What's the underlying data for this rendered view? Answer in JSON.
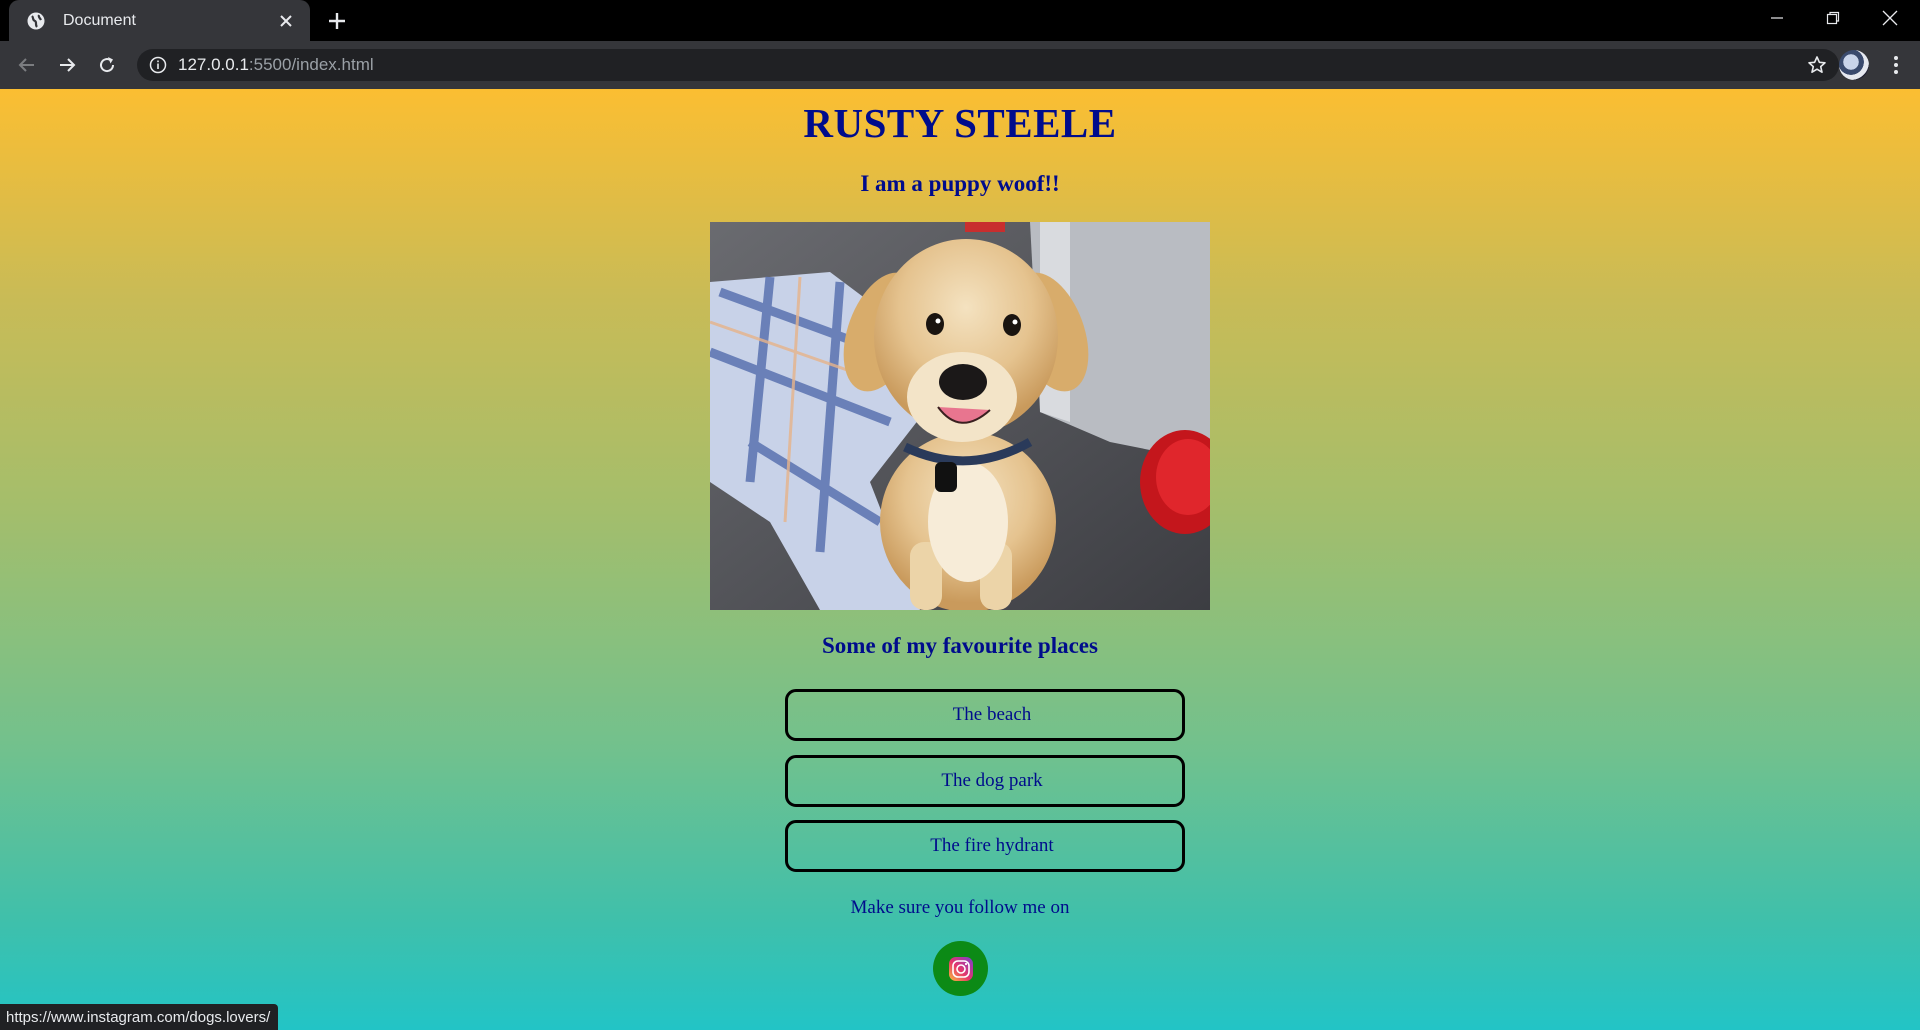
{
  "browser": {
    "tab_title": "Document",
    "url_host": "127.0.0.1",
    "url_rest": ":5500/index.html",
    "status_url": "https://www.instagram.com/dogs.lovers/"
  },
  "page": {
    "title": "RUSTY STEELE",
    "subtitle": "I am a puppy woof!!",
    "photo_alt": "puppy",
    "places_heading": "Some of my favourite places",
    "places": [
      {
        "label": "The beach"
      },
      {
        "label": "The dog park"
      },
      {
        "label": "The fire hydrant"
      }
    ],
    "follow_text": "Make sure you follow me on",
    "social_icon": "instagram-icon"
  },
  "colors": {
    "text": "#000c8c",
    "gradient_top": "#fbbe32",
    "gradient_bottom": "#22c4c6",
    "instagram_button": "#0c8a16"
  }
}
